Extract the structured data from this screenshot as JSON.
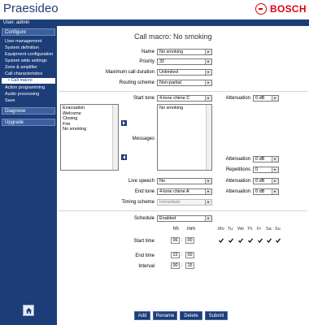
{
  "app": {
    "title": "Praesideo",
    "brand": "BOSCH",
    "user": "User: admin"
  },
  "sidebar": {
    "configure": "Configure",
    "configure_items": [
      "User management",
      "System definition",
      "Equipment configuration",
      "System wide settings",
      "Zone & amplifier",
      "Call characteristics"
    ],
    "active_sub": "• Call macro",
    "after_items": [
      "Action programming",
      "Audio processing",
      "Save"
    ],
    "diagnose": "Diagnose",
    "upgrade": "Upgrade"
  },
  "page": {
    "title": "Call macro: No smoking"
  },
  "form": {
    "name_label": "Name",
    "name_value": "No smoking",
    "priority_label": "Priority",
    "priority_value": "32",
    "max_duration_label": "Maximum call duration",
    "max_duration_value": "Unlimited",
    "routing_label": "Routing scheme",
    "routing_value": "Non-partial",
    "start_tone_label": "Start tone",
    "start_tone_value": "4-tone chime C",
    "attenuation_label": "Attenuation",
    "attenuation_start_value": "0 dB",
    "messages_label": "Messages",
    "available_messages": [
      "Evacuation",
      "Welcome",
      "Closing",
      "Fire",
      "No smoking"
    ],
    "selected_messages": [
      "No smoking"
    ],
    "attenuation_msg_value": "0 dB",
    "repetitions_label": "Repetitions",
    "repetitions_value": "0",
    "live_speech_label": "Live speech",
    "live_speech_value": "No",
    "attenuation_live_value": "0 dB",
    "end_tone_label": "End tone",
    "end_tone_value": "4-tone chime A",
    "attenuation_end_value": "0 dB",
    "timing_label": "Timing scheme",
    "timing_value": "Immediate"
  },
  "schedule": {
    "label": "Schedule",
    "value": "Enabled",
    "hh": "hh",
    "mm": "mm",
    "days": [
      "Mo",
      "Tu",
      "We",
      "Th",
      "Fr",
      "Sa",
      "Su"
    ],
    "days_checked": [
      true,
      true,
      true,
      true,
      true,
      true,
      true
    ],
    "start_label": "Start time",
    "start_hh": "06",
    "start_mm": "00",
    "end_label": "End time",
    "end_hh": "22",
    "end_mm": "00",
    "interval_label": "Interval",
    "interval_hh": "00",
    "interval_mm": "15"
  },
  "buttons": {
    "add": "Add",
    "rename": "Rename",
    "delete": "Delete",
    "submit": "Submit"
  },
  "colors": {
    "brand_blue": "#1c3d78",
    "bosch_red": "#e20015"
  }
}
